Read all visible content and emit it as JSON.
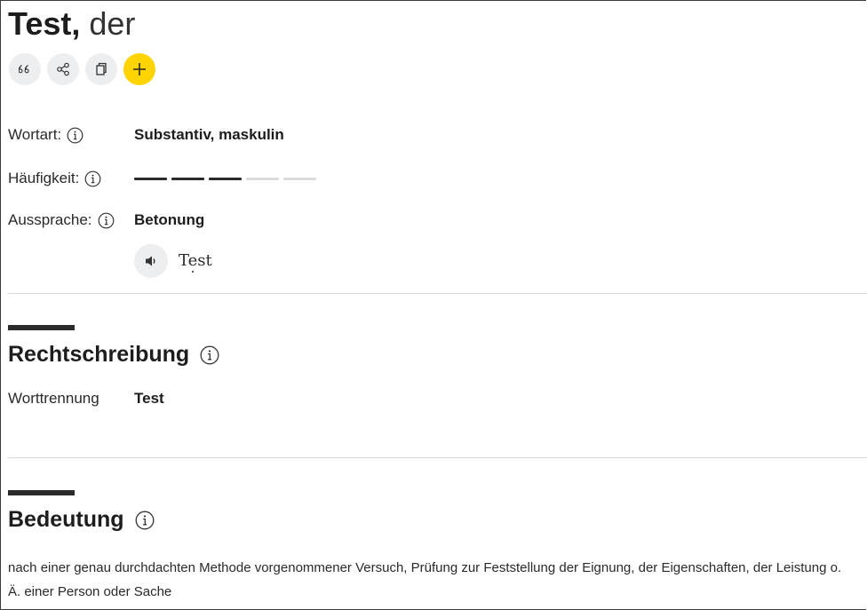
{
  "entry": {
    "lemma": "Test,",
    "article": "der"
  },
  "actions": [
    {
      "name": "quote-icon",
      "label": "Zitieren"
    },
    {
      "name": "share-icon",
      "label": "Teilen"
    },
    {
      "name": "copy-icon",
      "label": "Kopieren"
    },
    {
      "name": "plus-icon",
      "label": "Hinzufügen"
    }
  ],
  "overview": {
    "wortart_label": "Wortart:",
    "wortart_value": "Substantiv, maskulin",
    "haeufigkeit_label": "Häufigkeit:",
    "haeufigkeit_level": 3,
    "haeufigkeit_max": 5,
    "aussprache_label": "Aussprache:",
    "betonung_label": "Betonung",
    "pronunciation_prefix": "T",
    "pronunciation_stressed": "e",
    "pronunciation_suffix": "st"
  },
  "rechtschreibung": {
    "heading": "Rechtschreibung",
    "worttrennung_label": "Worttrennung",
    "worttrennung_value": "Test"
  },
  "bedeutung": {
    "heading": "Bedeutung",
    "text": "nach einer genau durchdachten Methode vorgenommener Versuch, Prüfung zur Feststellung der Eignung, der Eigenschaften, der Leistung o. Ä. einer Person oder Sache"
  },
  "colors": {
    "accent_yellow": "#ffd400",
    "button_grey": "#eceef0",
    "bar_dark": "#2b2b2b",
    "bar_light": "#dcdcdc"
  }
}
